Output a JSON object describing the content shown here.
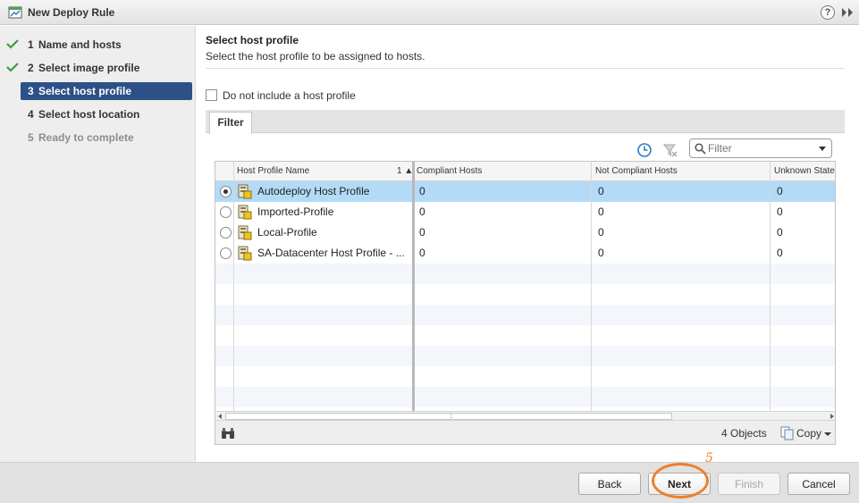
{
  "window": {
    "title": "New Deploy Rule",
    "help_label": "?"
  },
  "steps": [
    {
      "num": "1",
      "label": "Name and hosts",
      "state": "done"
    },
    {
      "num": "2",
      "label": "Select image profile",
      "state": "done"
    },
    {
      "num": "3",
      "label": "Select host profile",
      "state": "active"
    },
    {
      "num": "4",
      "label": "Select host location",
      "state": "pending"
    },
    {
      "num": "5",
      "label": "Ready to complete",
      "state": "disabled"
    }
  ],
  "main": {
    "title": "Select host profile",
    "subtitle": "Select the host profile to be assigned to hosts.",
    "no_profile_label": "Do not include a host profile",
    "no_profile_checked": false,
    "tab_label": "Filter",
    "filter_placeholder": "Filter"
  },
  "grid": {
    "columns": [
      "Host Profile Name",
      "Compliant Hosts",
      "Not Compliant Hosts",
      "Unknown State"
    ],
    "sort_indicator": "1 ▲",
    "rows": [
      {
        "name": "Autodeploy Host Profile",
        "compliant": "0",
        "not_compliant": "0",
        "unknown": "0",
        "selected": true
      },
      {
        "name": "Imported-Profile",
        "compliant": "0",
        "not_compliant": "0",
        "unknown": "0",
        "selected": false
      },
      {
        "name": "Local-Profile",
        "compliant": "0",
        "not_compliant": "0",
        "unknown": "0",
        "selected": false
      },
      {
        "name": "SA-Datacenter Host Profile - ...",
        "compliant": "0",
        "not_compliant": "0",
        "unknown": "0",
        "selected": false
      }
    ],
    "object_count": "4 Objects",
    "copy_label": "Copy"
  },
  "buttons": {
    "back": "Back",
    "next": "Next",
    "finish": "Finish",
    "cancel": "Cancel"
  },
  "annotation": {
    "marker": "5",
    "color": "#ef7f2b"
  },
  "colors": {
    "active_step": "#2d5187",
    "selected_row": "#b3dbf7",
    "check": "#3aa03a"
  }
}
